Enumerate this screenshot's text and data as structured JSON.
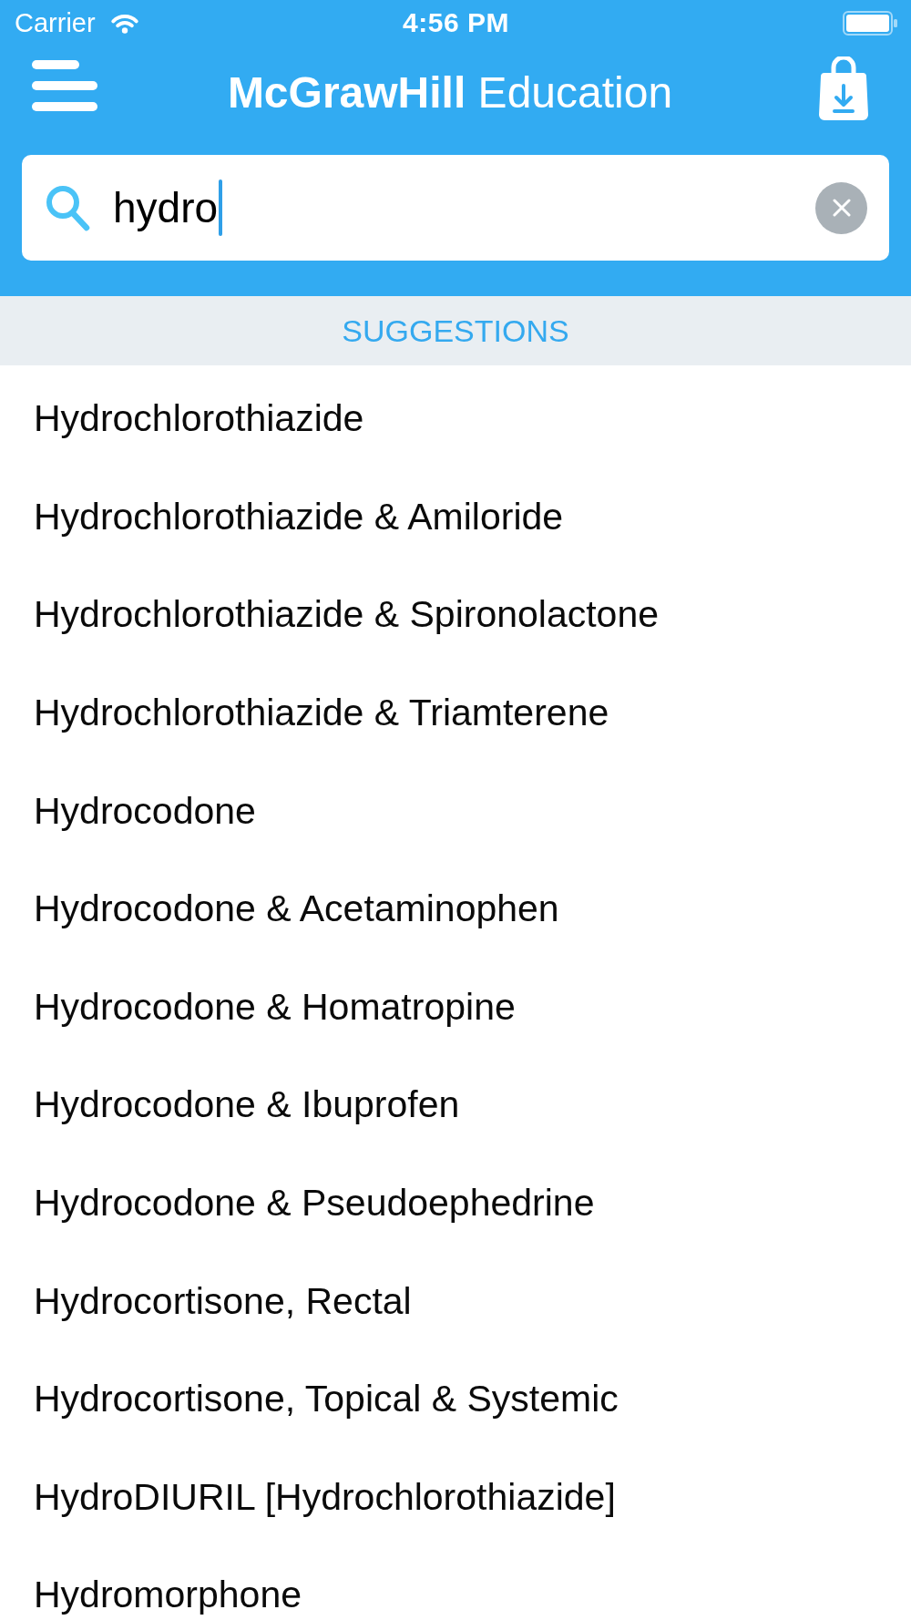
{
  "status_bar": {
    "carrier": "Carrier",
    "time": "4:56 PM"
  },
  "nav_bar": {
    "title": "**McGrawHill** Education"
  },
  "search": {
    "value": "hydro",
    "focused": true
  },
  "suggestions": {
    "heading": "SUGGESTIONS",
    "items": [
      "Hydrochlorothiazide",
      "Hydrochlorothiazide & Amiloride",
      "Hydrochlorothiazide & Spironolactone",
      "Hydrochlorothiazide & Triamterene",
      "Hydrocodone",
      "Hydrocodone & Acetaminophen",
      "Hydrocodone & Homatropine",
      "Hydrocodone & Ibuprofen",
      "Hydrocodone & Pseudoephedrine",
      "Hydrocortisone, Rectal",
      "Hydrocortisone, Topical & Systemic",
      "HydroDIURIL [Hydrochlorothiazide]",
      "Hydromorphone"
    ]
  }
}
